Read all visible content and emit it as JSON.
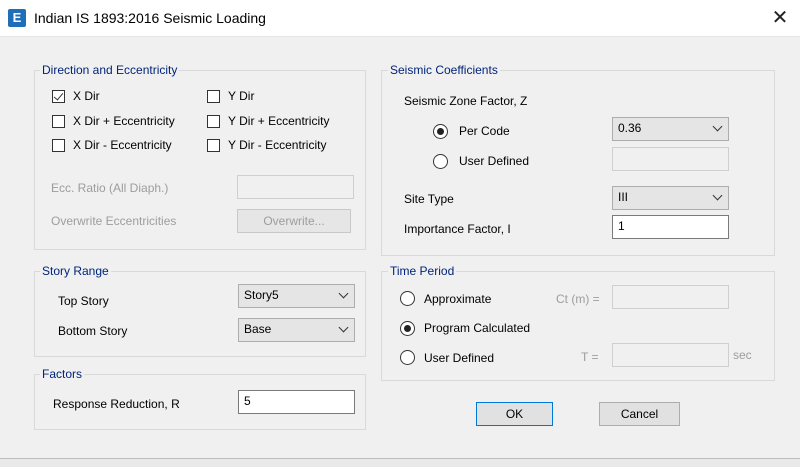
{
  "window": {
    "title": "Indian IS 1893:2016 Seismic Loading",
    "app_icon": "E",
    "close_glyph": "✕"
  },
  "direction": {
    "legend": "Direction and Eccentricity",
    "x_dir": {
      "label": "X Dir",
      "checked": true
    },
    "x_dir_plus_ecc": {
      "label": "X Dir + Eccentricity",
      "checked": false
    },
    "x_dir_minus_ecc": {
      "label": "X Dir - Eccentricity",
      "checked": false
    },
    "y_dir": {
      "label": "Y Dir",
      "checked": false
    },
    "y_dir_plus_ecc": {
      "label": "Y Dir + Eccentricity",
      "checked": false
    },
    "y_dir_minus_ecc": {
      "label": "Y Dir - Eccentricity",
      "checked": false
    },
    "ecc_ratio_label": "Ecc. Ratio (All Diaph.)",
    "ecc_ratio_value": "",
    "overwrite_label": "Overwrite Eccentricities",
    "overwrite_button": "Overwrite..."
  },
  "story_range": {
    "legend": "Story Range",
    "top_label": "Top Story",
    "top_value": "Story5",
    "bottom_label": "Bottom Story",
    "bottom_value": "Base"
  },
  "factors": {
    "legend": "Factors",
    "response_label": "Response Reduction, R",
    "response_value": "5"
  },
  "seismic": {
    "legend": "Seismic Coefficients",
    "zone_label": "Seismic Zone Factor, Z",
    "per_code_label": "Per Code",
    "per_code_value": "0.36",
    "user_defined_label": "User Defined",
    "user_defined_value": "",
    "site_type_label": "Site Type",
    "site_type_value": "III",
    "importance_label": "Importance Factor, I",
    "importance_value": "1"
  },
  "time_period": {
    "legend": "Time Period",
    "approximate_label": "Approximate",
    "ct_label": "Ct (m) =",
    "ct_value": "",
    "program_label": "Program Calculated",
    "user_defined_label": "User Defined",
    "t_label": "T =",
    "t_value": "",
    "sec_label": "sec"
  },
  "buttons": {
    "ok": "OK",
    "cancel": "Cancel"
  }
}
